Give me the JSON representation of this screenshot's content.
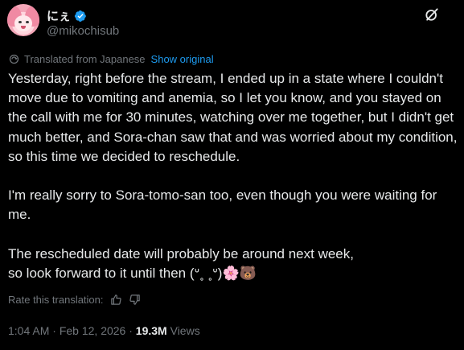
{
  "post": {
    "display_name": "にぇ",
    "handle": "@mikochisub",
    "translated_from": "Translated from Japanese",
    "show_original": "Show original",
    "body": "Yesterday, right before the stream, I ended up in a state where I couldn't move due to vomiting and anemia, so I let you know, and you stayed on the call with me for 30 minutes, watching over me together, but I didn't get much better, and Sora-chan saw that and was worried about my condition, so this time we decided to reschedule.\n\nI'm really sorry to Sora-tomo-san too, even though you were waiting for me.\n\nThe rescheduled date will probably be around next week,\nso look forward to it until then (ᐡ˳ ˳ᐡ)🌸🐻",
    "rate_label": "Rate this translation:",
    "time": "1:04 AM",
    "separator": "·",
    "date": "Feb 12, 2026",
    "views_count": "19.3M",
    "views_label": "Views"
  },
  "colors": {
    "background": "#000000",
    "text": "#e7e9ea",
    "muted": "#71767b",
    "link": "#1d9bf0"
  },
  "icons": [
    "verified-badge-icon",
    "grok-icon",
    "translate-icon",
    "thumbs-up-icon",
    "thumbs-down-icon"
  ]
}
